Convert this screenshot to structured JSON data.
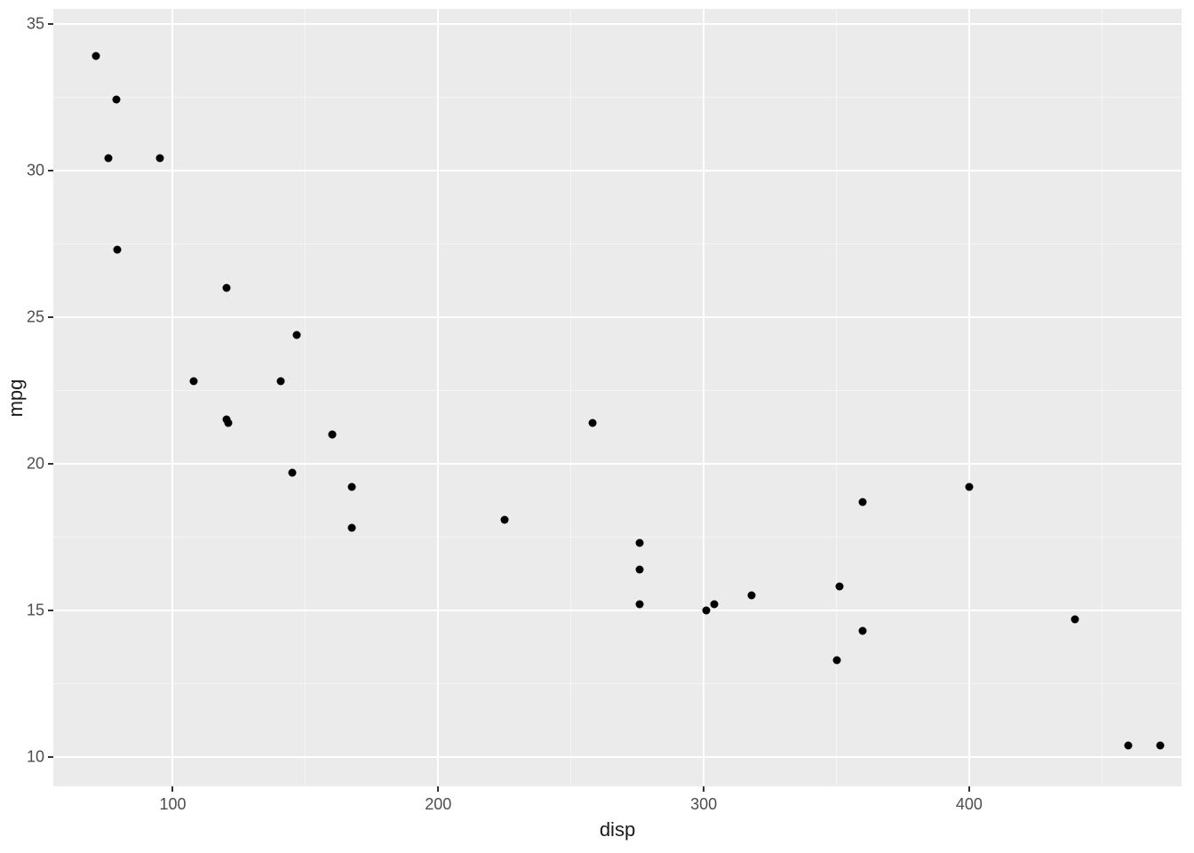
{
  "chart_data": {
    "type": "scatter",
    "xlabel": "disp",
    "ylabel": "mpg",
    "xlim": [
      55,
      480
    ],
    "ylim": [
      9,
      35.5
    ],
    "x_ticks": [
      100,
      200,
      300,
      400
    ],
    "y_ticks": [
      10,
      15,
      20,
      25,
      30,
      35
    ],
    "points": [
      {
        "x": 71.1,
        "y": 33.9
      },
      {
        "x": 75.7,
        "y": 30.4
      },
      {
        "x": 78.7,
        "y": 32.4
      },
      {
        "x": 79.0,
        "y": 27.3
      },
      {
        "x": 95.1,
        "y": 30.4
      },
      {
        "x": 108.0,
        "y": 22.8
      },
      {
        "x": 120.1,
        "y": 21.5
      },
      {
        "x": 120.3,
        "y": 26.0
      },
      {
        "x": 121.0,
        "y": 21.4
      },
      {
        "x": 140.8,
        "y": 22.8
      },
      {
        "x": 145.0,
        "y": 19.7
      },
      {
        "x": 146.7,
        "y": 24.4
      },
      {
        "x": 160.0,
        "y": 21.0
      },
      {
        "x": 160.0,
        "y": 21.0
      },
      {
        "x": 167.6,
        "y": 19.2
      },
      {
        "x": 167.6,
        "y": 17.8
      },
      {
        "x": 225.0,
        "y": 18.1
      },
      {
        "x": 258.0,
        "y": 21.4
      },
      {
        "x": 275.8,
        "y": 17.3
      },
      {
        "x": 275.8,
        "y": 16.4
      },
      {
        "x": 275.8,
        "y": 15.2
      },
      {
        "x": 301.0,
        "y": 15.0
      },
      {
        "x": 304.0,
        "y": 15.2
      },
      {
        "x": 318.0,
        "y": 15.5
      },
      {
        "x": 350.0,
        "y": 13.3
      },
      {
        "x": 351.0,
        "y": 15.8
      },
      {
        "x": 360.0,
        "y": 18.7
      },
      {
        "x": 360.0,
        "y": 14.3
      },
      {
        "x": 400.0,
        "y": 19.2
      },
      {
        "x": 440.0,
        "y": 14.7
      },
      {
        "x": 460.0,
        "y": 10.4
      },
      {
        "x": 472.0,
        "y": 10.4
      }
    ]
  }
}
